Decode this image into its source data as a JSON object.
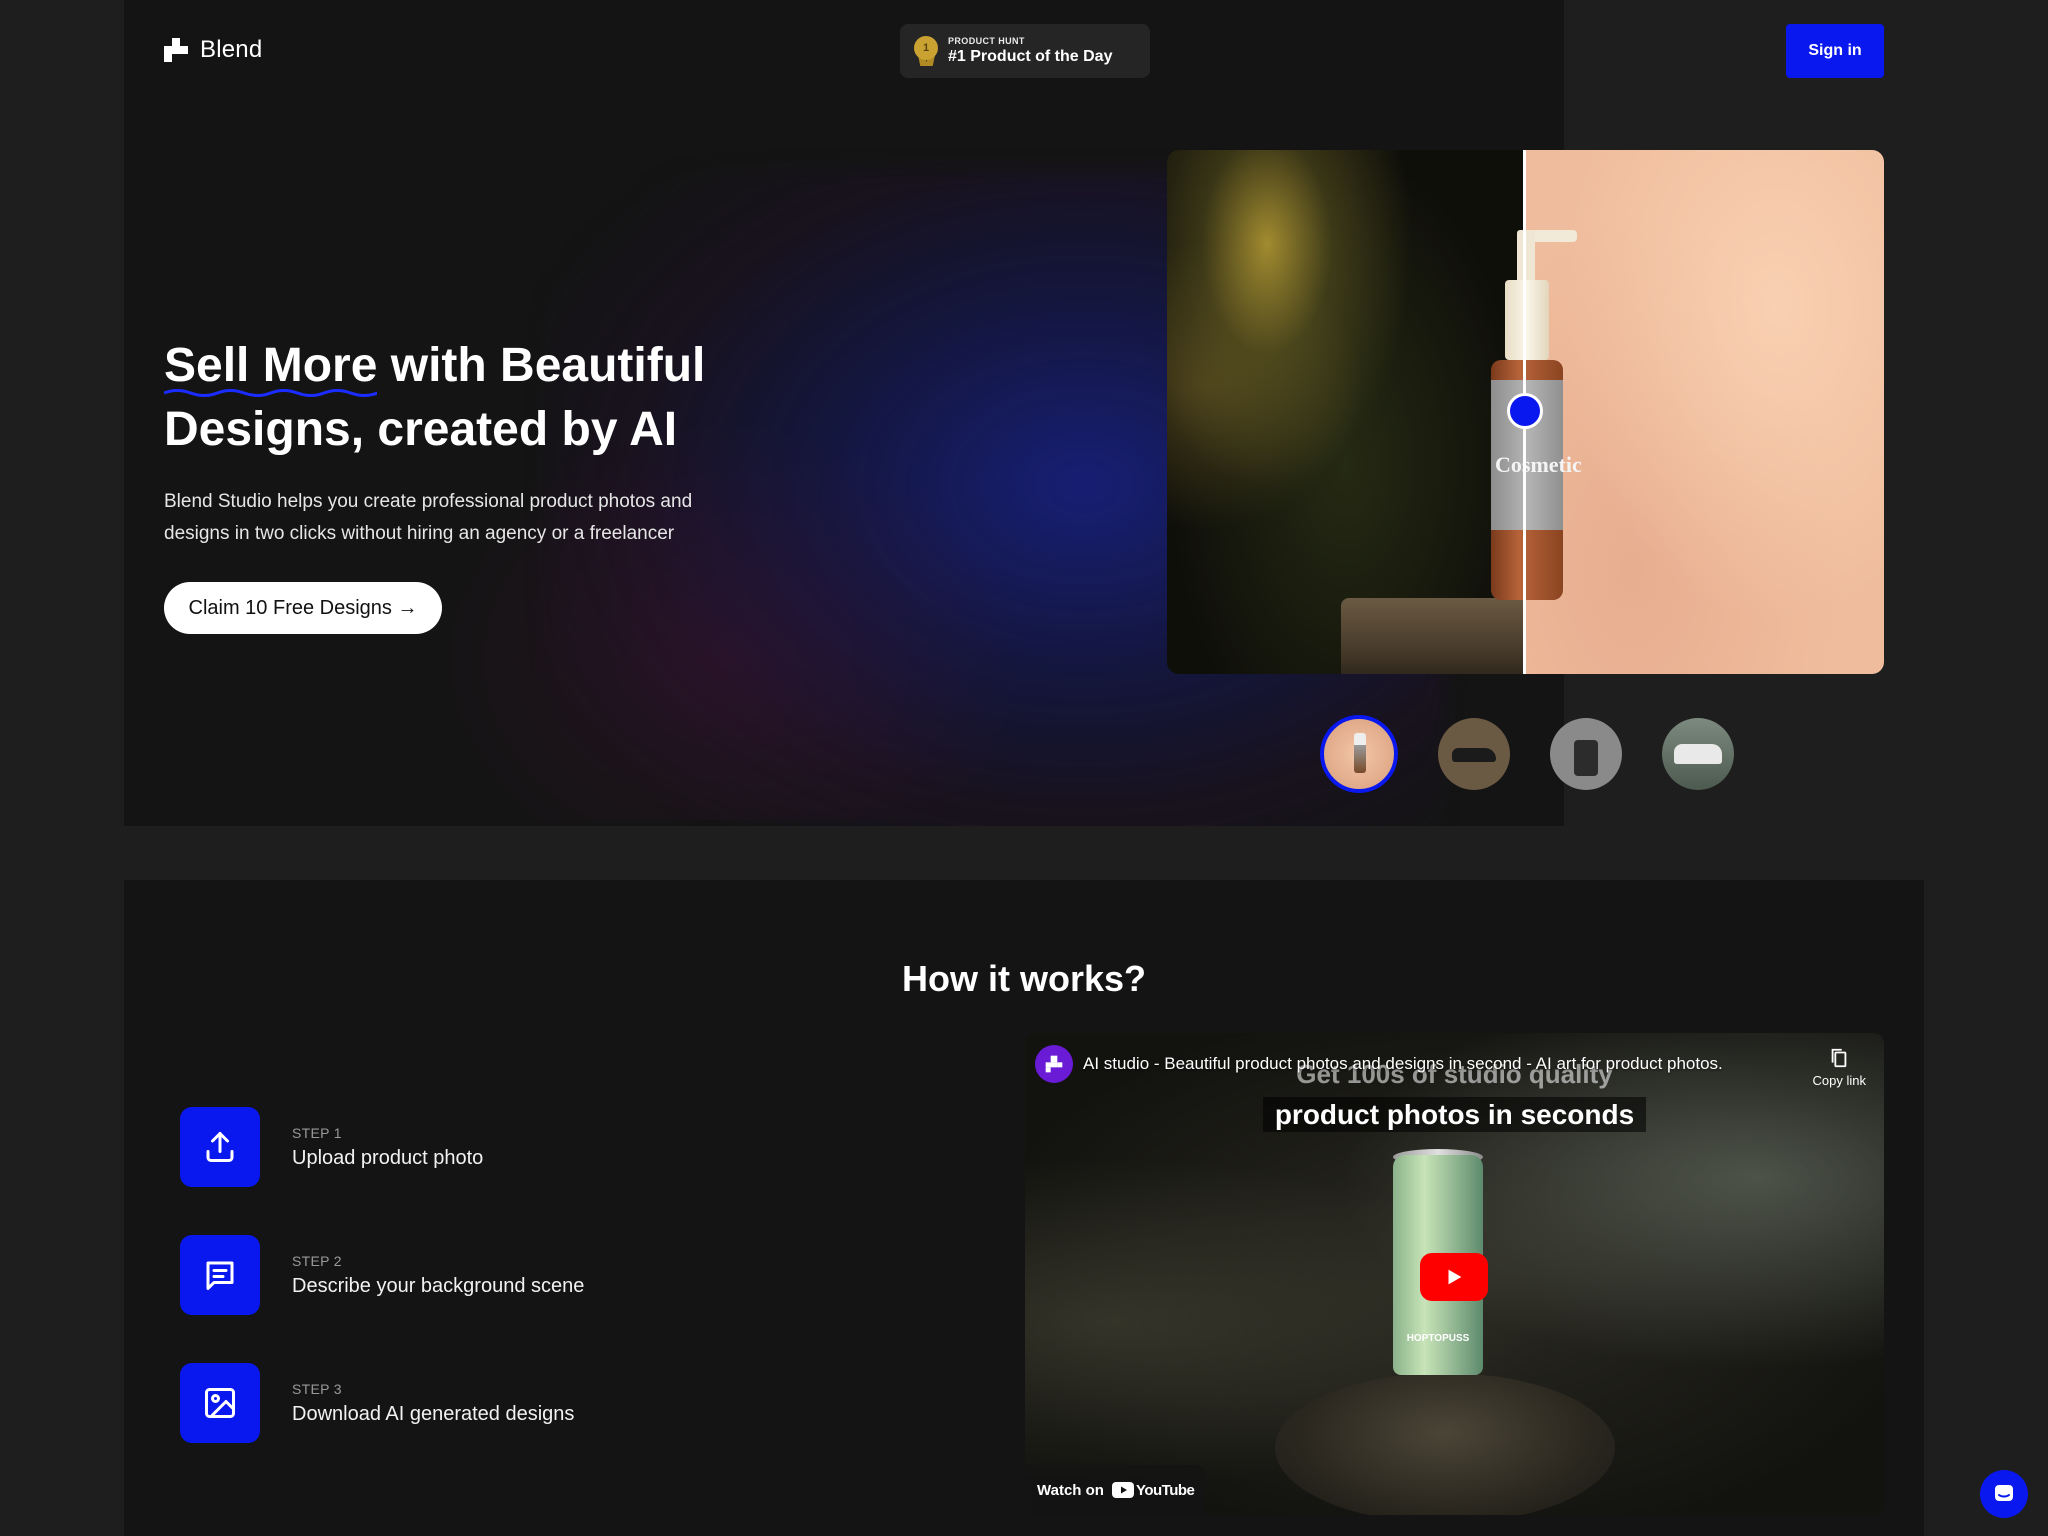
{
  "header": {
    "logo_text": "Blend",
    "badge_small": "PRODUCT HUNT",
    "badge_big": "#1 Product of the Day",
    "signin_label": "Sign in"
  },
  "hero": {
    "title_underlined": "Sell More",
    "title_rest": " with Beautiful Designs, created by AI",
    "subtitle": "Blend Studio helps you create professional product photos and designs in two clicks without hiring an agency or a freelancer",
    "cta_label": "Claim 10 Free Designs →",
    "bottle_label": "Cosmetic"
  },
  "how": {
    "title": "How it works?",
    "steps": [
      {
        "label": "STEP 1",
        "text": "Upload product photo",
        "icon": "upload-icon"
      },
      {
        "label": "STEP 2",
        "text": "Describe your background scene",
        "icon": "message-icon"
      },
      {
        "label": "STEP 3",
        "text": "Download AI generated designs",
        "icon": "image-icon"
      }
    ]
  },
  "video": {
    "title": "AI studio - Beautiful product photos and designs in second - AI art for product photos.",
    "overlay_line1": "Get 100s of studio quality",
    "overlay_line2": "product photos in seconds",
    "copy_label": "Copy link",
    "watch_label": "Watch on",
    "youtube_label": "YouTube",
    "can_label": "HOPTOPUSS"
  },
  "colors": {
    "accent": "#0a18f0",
    "background": "#1e1e1e",
    "panel": "#141414"
  }
}
